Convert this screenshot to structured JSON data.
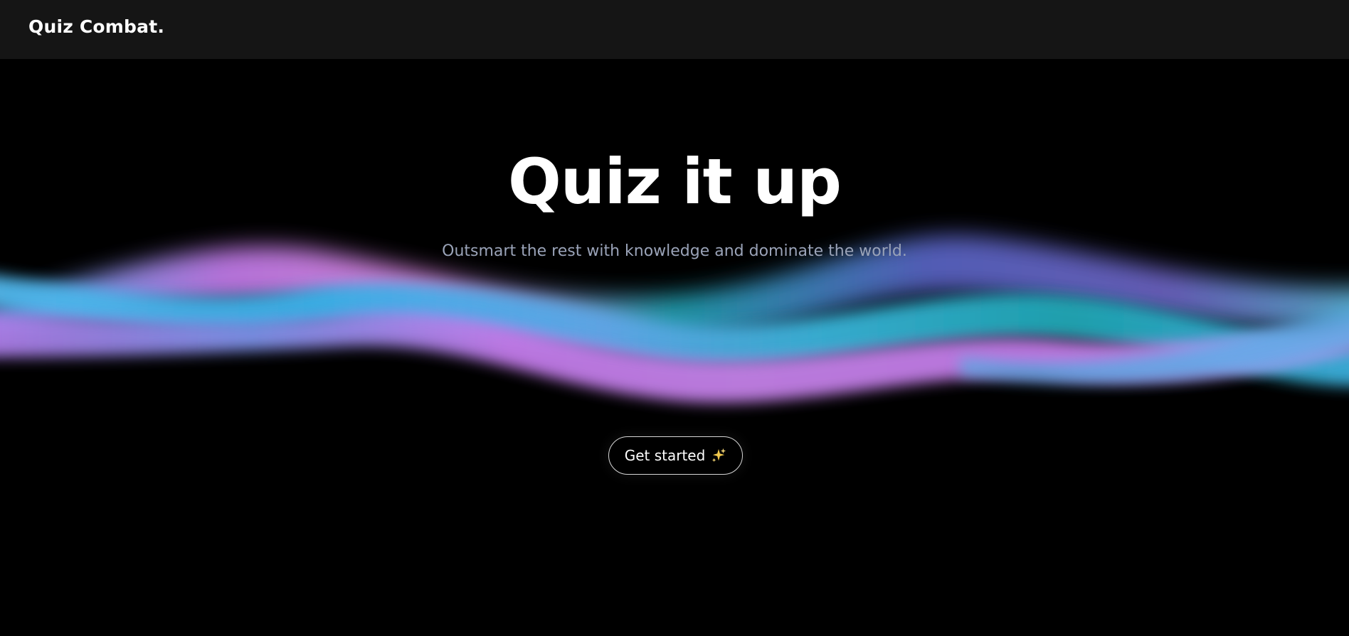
{
  "navbar": {
    "brand": "Quiz Combat."
  },
  "hero": {
    "title": "Quiz it up",
    "subtitle": "Outsmart the rest with knowledge and dominate the world.",
    "cta_label": "Get started",
    "cta_icon": "sparkles-icon"
  },
  "colors": {
    "navbar_bg": "#151515",
    "page_bg": "#000000",
    "subtitle": "#9aa3b8",
    "wave_cyan": "#3ab0e8",
    "wave_pink": "#c77ef0",
    "wave_teal": "#1fa7b5",
    "wave_indigo": "#5b66c9",
    "sparkle": "#f2c94c"
  }
}
